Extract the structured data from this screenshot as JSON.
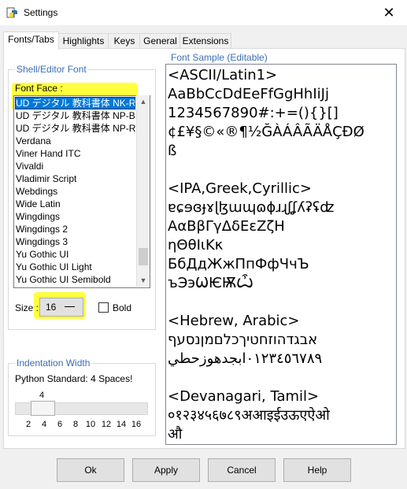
{
  "window": {
    "title": "Settings",
    "close_glyph": "✕"
  },
  "tabs": [
    {
      "label": "Fonts/Tabs"
    },
    {
      "label": "Highlights"
    },
    {
      "label": "Keys"
    },
    {
      "label": "General"
    },
    {
      "label": "Extensions"
    }
  ],
  "font_group": {
    "title": "Shell/Editor Font",
    "font_face_label": "Font Face :",
    "fonts": [
      "UD デジタル 教科書体 NK-R",
      "UD デジタル 教科書体 NP-B",
      "UD デジタル 教科書体 NP-R",
      "Verdana",
      "Viner Hand ITC",
      "Vivaldi",
      "Vladimir Script",
      "Webdings",
      "Wide Latin",
      "Wingdings",
      "Wingdings 2",
      "Wingdings 3",
      "Yu Gothic UI",
      "Yu Gothic UI Light",
      "Yu Gothic UI Semibold"
    ],
    "selected_index": 0,
    "size_label": "Size :",
    "size_value": "16",
    "bold_label": "Bold",
    "bold_checked": false,
    "scroll_up": "▲",
    "scroll_down": "▼"
  },
  "indent_group": {
    "title": "Indentation Width",
    "description": "Python Standard: 4 Spaces!",
    "value": "4",
    "ticks": [
      "2",
      "4",
      "6",
      "8",
      "10",
      "12",
      "14",
      "16"
    ]
  },
  "sample": {
    "title": "Font Sample (Editable)",
    "lines": [
      "<ASCII/Latin1>",
      "AaBbCcDdEeFfGgHhIiJj",
      "1234567890#:+=(){}[]",
      "¢£¥§©«®¶½ĞÀÁÂÃÄÅÇÐØ",
      "ß",
      "",
      "<IPA,Greek,Cyrillic>",
      "ɐɕɘɞɟɤɭɮɯɰɷɸɹɻʃʆʎʡʢʣ",
      "ΑαΒβΓγΔδΕεΖζΗ",
      "ηΘθΙιΚκ",
      "БбДдЖжПпФфЧчЪ",
      "ъЭэѠѤѬѼ",
      "",
      "<Hebrew, Arabic>",
      "אבגדהוזחטיךכלםמןנסעף",
      "٠١٢٣٤٥٦٧٨٩ابجدهوزحطي",
      "",
      "<Devanagari, Tamil>",
      "०१२३४५६७८९अआइईउऊएऐओ",
      "औ"
    ]
  },
  "buttons": {
    "ok": "Ok",
    "apply": "Apply",
    "cancel": "Cancel",
    "help": "Help"
  },
  "colors": {
    "selection": "#0078d7",
    "group_title": "#3a6fb5",
    "highlight": "#ffff00"
  }
}
